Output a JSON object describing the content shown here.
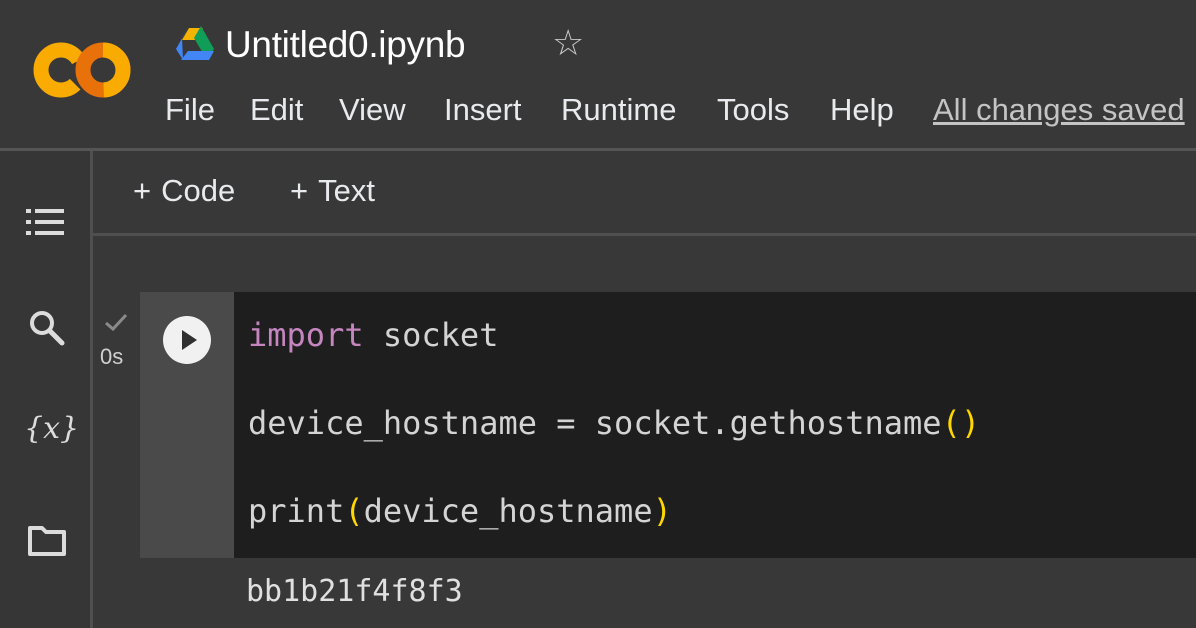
{
  "header": {
    "logo_text": "CO",
    "notebook_title": "Untitled0.ipynb",
    "menu": [
      {
        "label": "File"
      },
      {
        "label": "Edit"
      },
      {
        "label": "View"
      },
      {
        "label": "Insert"
      },
      {
        "label": "Runtime"
      },
      {
        "label": "Tools"
      },
      {
        "label": "Help"
      }
    ],
    "save_status": "All changes saved"
  },
  "sidebar": {
    "icons": [
      "table-of-contents-icon",
      "search-icon",
      "variables-icon",
      "files-folder-icon"
    ],
    "variables_icon_text": "{x}"
  },
  "toolbar": {
    "add_code_label": "Code",
    "add_text_label": "Text"
  },
  "cell": {
    "execution_status": "✓",
    "execution_time": "0s",
    "code": {
      "line1_keyword": "import",
      "line1_module": "socket",
      "line2_lhs": "device_hostname = socket.gethostname",
      "line2_paren": "()",
      "line3_func": "print",
      "line3_open": "(",
      "line3_arg": "device_hostname",
      "line3_close": ")"
    },
    "output": "bb1b21f4f8f3"
  },
  "colors": {
    "logo_orange": "#F9AB00",
    "logo_dark_orange": "#E8710A",
    "keyword": "#C586C0",
    "paren": "#FFD700",
    "background": "#383838",
    "editor_background": "#1E1E1E"
  }
}
